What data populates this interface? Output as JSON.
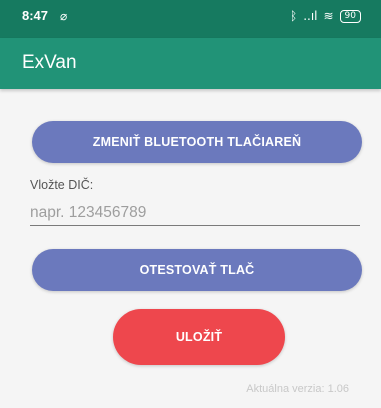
{
  "status_bar": {
    "time": "8:47",
    "left_icon": "⌀",
    "bluetooth_icon": "bluetooth-icon",
    "signal_icon": "signal-icon",
    "wifi_icon": "wifi-icon",
    "battery_level": "90",
    "bluetooth_glyph": "ᛒ",
    "signal_glyph": "..ıl",
    "wifi_glyph": "≋"
  },
  "app_bar": {
    "title": "ExVan"
  },
  "form": {
    "change_printer_label": "ZMENIŤ BLUETOOTH TLAČIAREŇ",
    "dic_label": "Vložte DIČ:",
    "dic_value": "",
    "dic_placeholder": "napr. 123456789",
    "test_printer_label": "OTESTOVAŤ TLAČ",
    "save_label": "ULOŽIŤ"
  },
  "footer": {
    "version": "Aktuálna verzia: 1.06"
  },
  "colors": {
    "status_bar": "#167a60",
    "app_bar": "#219377",
    "primary_button": "#6b79bd",
    "save_button": "#ee474d",
    "background": "#f5f5f5"
  }
}
